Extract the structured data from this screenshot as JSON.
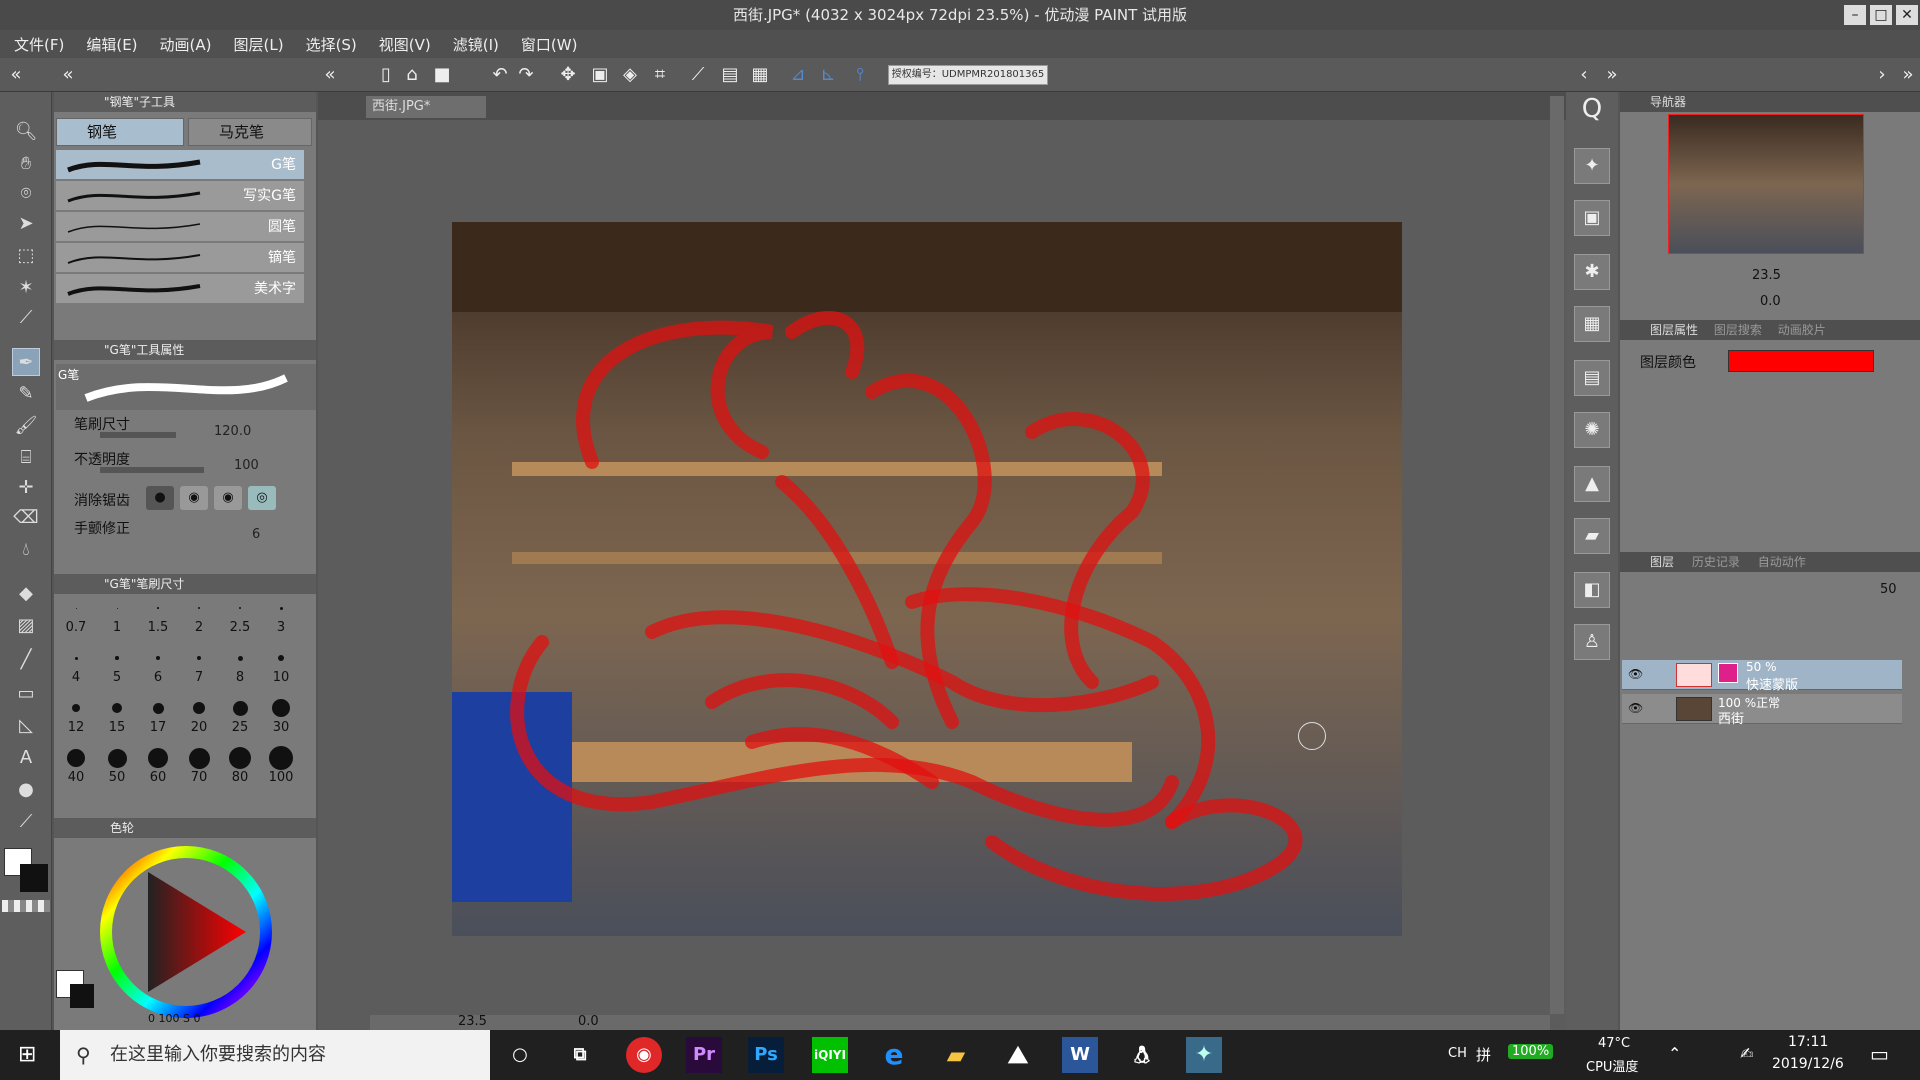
{
  "window": {
    "title": "西街.JPG* (4032 x 3024px 72dpi 23.5%) - 优动漫 PAINT 试用版"
  },
  "menu": [
    "文件(F)",
    "编辑(E)",
    "动画(A)",
    "图层(L)",
    "选择(S)",
    "视图(V)",
    "滤镜(I)",
    "窗口(W)"
  ],
  "toolbar": {
    "license": "授权编号：UDMPMR201801365"
  },
  "subtool": {
    "header": "\"钢笔\"子工具",
    "tabs": [
      "钢笔",
      "马克笔"
    ],
    "brushes": [
      "G笔",
      "写实G笔",
      "圆笔",
      "镝笔",
      "美术字"
    ]
  },
  "toolprop": {
    "header": "\"G笔\"工具属性",
    "preview_label": "G笔",
    "brush_size_label": "笔刷尺寸",
    "brush_size_value": "120.0",
    "opacity_label": "不透明度",
    "opacity_value": "100",
    "antialias_label": "消除锯齿",
    "stabilize_label": "手颤修正",
    "stabilize_value": "6"
  },
  "brushsize": {
    "header": "\"G笔\"笔刷尺寸",
    "sizes": [
      "0.7",
      "1",
      "1.5",
      "2",
      "2.5",
      "3",
      "4",
      "5",
      "6",
      "7",
      "8",
      "10",
      "12",
      "15",
      "17",
      "20",
      "25",
      "30",
      "40",
      "50",
      "60",
      "70",
      "80",
      "100"
    ]
  },
  "color": {
    "tab_label": "色轮",
    "bottom_values": "0 100 S 0",
    "hue_color": "#ff0000"
  },
  "document": {
    "tab": "西街.JPG*",
    "zoom": "23.5",
    "rotation": "0.0"
  },
  "navigator": {
    "tab": "导航器",
    "zoom": "23.5",
    "rotation": "0.0"
  },
  "layer_props": {
    "tab": "图层属性",
    "tab2": "图层搜索",
    "tab3": "动画胶片",
    "color_label": "图层颜色",
    "layer_color": "#ff0000"
  },
  "layers": {
    "tab": "图层",
    "tab2": "历史记录",
    "tab3": "自动动作",
    "opacity": "50",
    "items": [
      {
        "percent": "50 %",
        "name": "快速蒙版"
      },
      {
        "percent": "100 %正常",
        "name": "西街"
      }
    ]
  },
  "taskbar": {
    "search_placeholder": "在这里输入你要搜索的内容",
    "apps": [
      "网易云",
      "Pr",
      "Ps",
      "iQIYI",
      "e",
      "文件夹",
      "照片",
      "W",
      "QQ",
      "优动漫"
    ],
    "lang": "CH",
    "ime": "拼",
    "battery": "100%",
    "cpu_temp": "47°C",
    "cpu_label": "CPU温度",
    "time": "17:11",
    "date": "2019/12/6"
  }
}
